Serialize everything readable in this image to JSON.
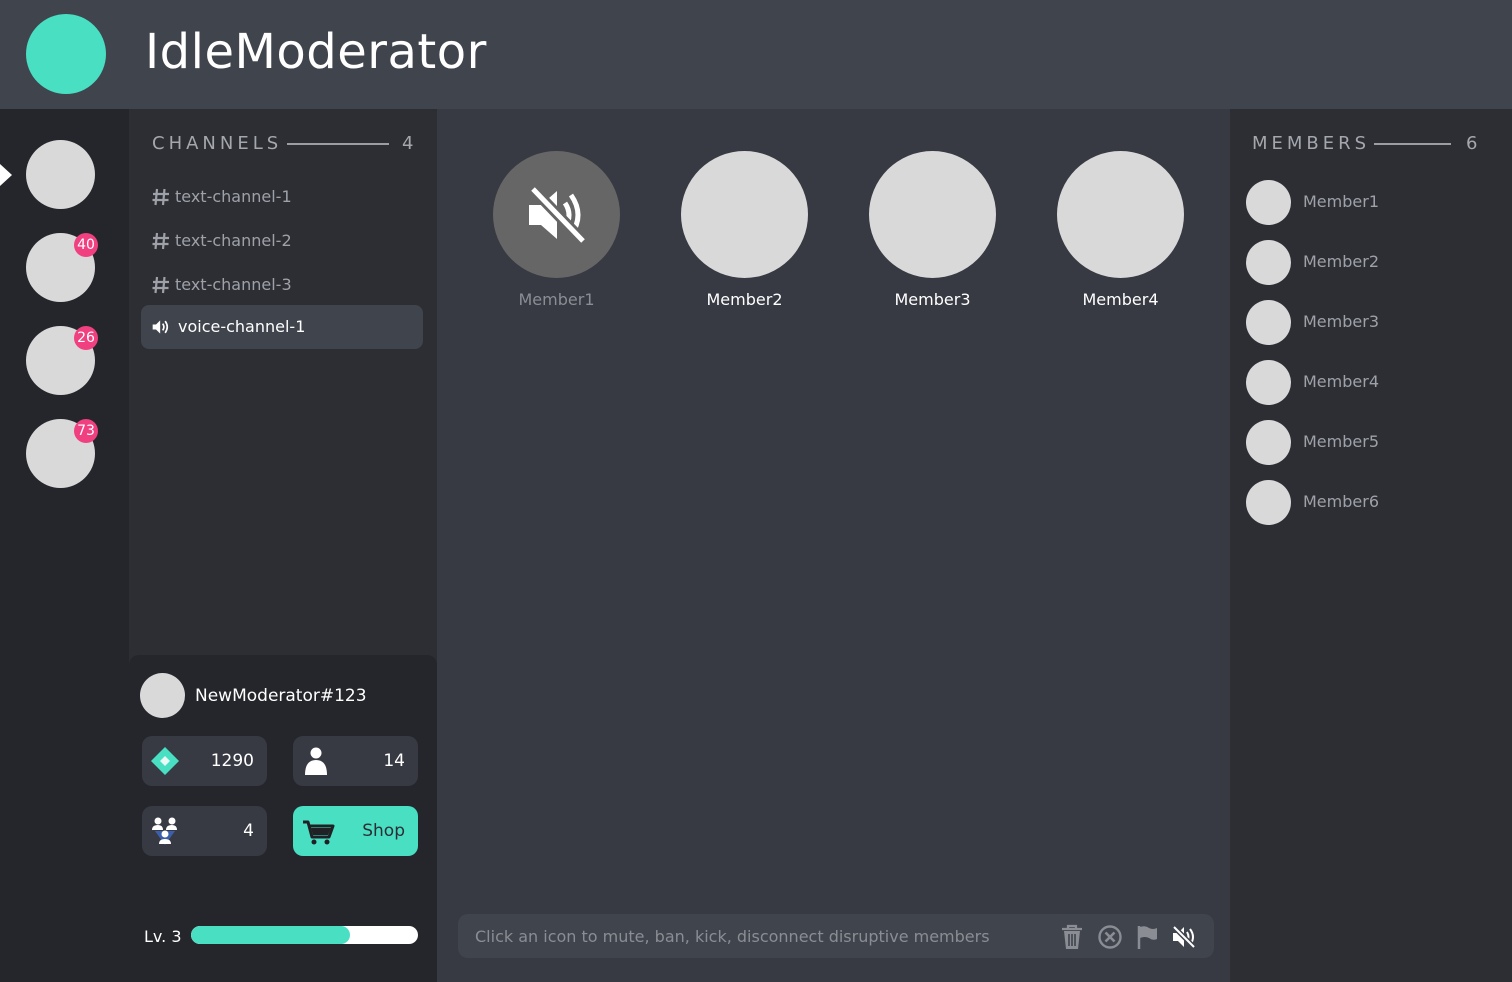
{
  "app": {
    "title": "IdleModerator",
    "brand_color": "#48dfc3",
    "badge_color": "#f0407f"
  },
  "servers": [
    {
      "badge": ""
    },
    {
      "badge": "40"
    },
    {
      "badge": "26"
    },
    {
      "badge": "73"
    }
  ],
  "channels": {
    "heading": "CHANNELS",
    "count": "4",
    "items": [
      {
        "label": "text-channel-1",
        "icon": "hash-icon"
      },
      {
        "label": "text-channel-2",
        "icon": "hash-icon"
      },
      {
        "label": "text-channel-3",
        "icon": "hash-icon"
      },
      {
        "label": "voice-channel-1",
        "icon": "speaker-icon",
        "active": true
      }
    ]
  },
  "profile": {
    "username": "NewModerator#123",
    "gems": "1290",
    "followers": "14",
    "team": "4",
    "shop_label": "Shop",
    "level_label": "Lv. 3",
    "level_progress": 0.7
  },
  "voice": {
    "members": [
      {
        "name": "Member1",
        "muted": true
      },
      {
        "name": "Member2",
        "muted": false
      },
      {
        "name": "Member3",
        "muted": false
      },
      {
        "name": "Member4",
        "muted": false
      }
    ]
  },
  "actions": {
    "hint": "Click an icon to mute, ban, kick, disconnect disruptive members",
    "icons": [
      "trash-icon",
      "ban-icon",
      "flag-icon",
      "mute-icon"
    ]
  },
  "members": {
    "heading": "MEMBERS",
    "count": "6",
    "items": [
      "Member1",
      "Member2",
      "Member3",
      "Member4",
      "Member5",
      "Member6"
    ]
  }
}
